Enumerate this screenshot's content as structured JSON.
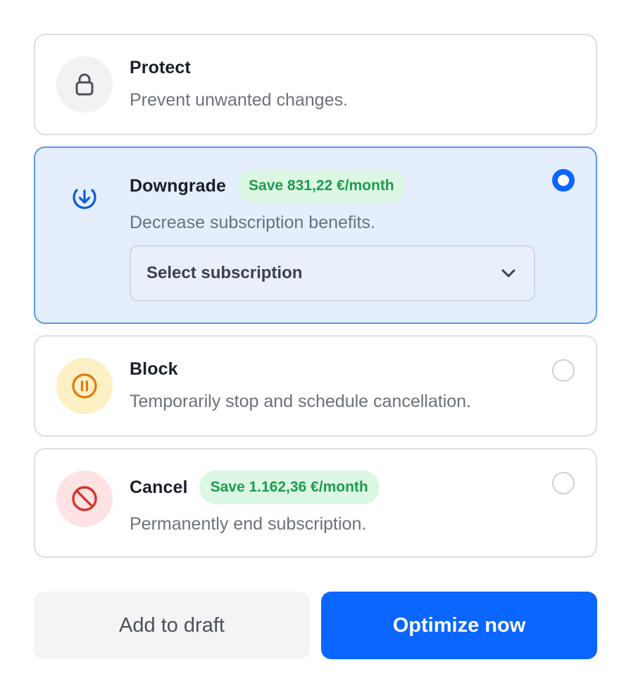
{
  "options": {
    "protect": {
      "title": "Protect",
      "description": "Prevent unwanted changes.",
      "icon": "lock-icon"
    },
    "downgrade": {
      "title": "Downgrade",
      "badge": "Save 831,22 €/month",
      "description": "Decrease subscription benefits.",
      "icon": "arrow-down-circle-icon",
      "selected": true,
      "select": {
        "label": "Select subscription",
        "icon": "chevron-down-icon"
      }
    },
    "block": {
      "title": "Block",
      "description": "Temporarily stop and schedule cancellation.",
      "icon": "pause-circle-icon",
      "selected": false
    },
    "cancel": {
      "title": "Cancel",
      "badge": "Save 1.162,36 €/month",
      "description": "Permanently end subscription.",
      "icon": "prohibited-icon",
      "selected": false
    }
  },
  "actions": {
    "add_to_draft": "Add to draft",
    "optimize_now": "Optimize now"
  },
  "colors": {
    "accent": "#0a66ff",
    "selected_bg": "#e4eefc",
    "badge_bg": "#dcf7e4",
    "badge_text": "#1e9b4d"
  }
}
